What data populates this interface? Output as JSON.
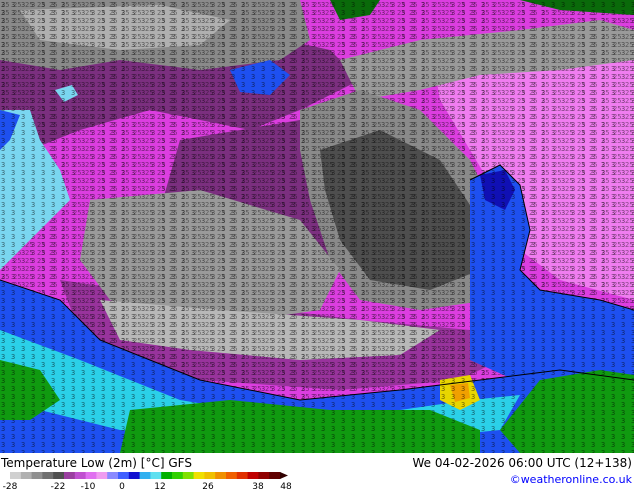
{
  "map": {
    "type": "temperature-field",
    "colors": {
      "deep_cold": "#3a3a3a",
      "cold_gray": "#8a8a8a",
      "light_gray": "#c4c4c4",
      "purple": "#7b2f7f",
      "magenta": "#dc3ee0",
      "pink": "#f07df0",
      "blue": "#1e50f0",
      "dark_blue": "#1010b4",
      "cyan": "#2bd0e8",
      "light_cyan": "#7ad6f0",
      "green": "#109a10",
      "dark_green": "#0a6a0a",
      "yellow": "#e8d600",
      "orange": "#f0a000"
    }
  },
  "footer": {
    "title": "Temperature Low (2m) [°C] GFS",
    "valid": "We 04-02-2026 06:00 UTC (12+138)",
    "credit": "©weatheronline.co.uk"
  },
  "legend": {
    "ticks": [
      "-28",
      "-22",
      "-10",
      "0",
      "12",
      "26",
      "38",
      "48"
    ],
    "colors": [
      "#d0d0d0",
      "#b0b0b0",
      "#909090",
      "#707070",
      "#505050",
      "#9a3fa0",
      "#c050d0",
      "#e070f0",
      "#f09cf0",
      "#8a8aff",
      "#4060ff",
      "#1010d0",
      "#30b0f0",
      "#60e0f0",
      "#00b000",
      "#30d000",
      "#80e000",
      "#f0e000",
      "#f0c000",
      "#f09000",
      "#f06000",
      "#e03000",
      "#c00000",
      "#900000",
      "#600000"
    ]
  }
}
